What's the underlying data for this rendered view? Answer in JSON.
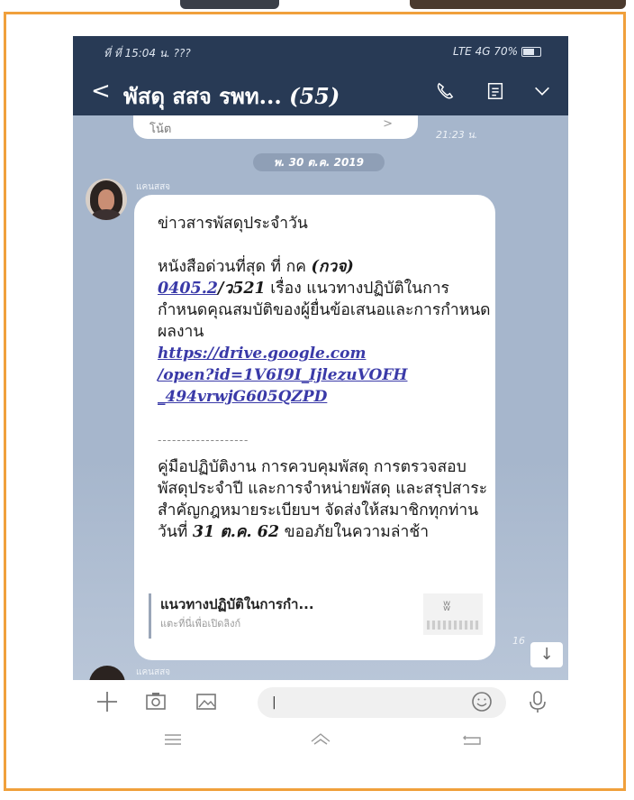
{
  "status_bar": {
    "left": "ที่ ที่ 15:04 น. ???",
    "right": "LTE 4G 70%"
  },
  "header": {
    "back_icon": "chevron-left-icon",
    "title": "พัสดุ สสจ รพท...",
    "member_count": "(55)",
    "icons": [
      "phone-icon",
      "notes-icon",
      "chevron-down-icon"
    ]
  },
  "chat": {
    "previous_bubble_text": "โน้ต",
    "previous_bubble_arrow": ">",
    "previous_time": "21:23 น.",
    "date_divider": "พ. 30 ต.ค. 2019",
    "sender_name": "แคนสสจ",
    "message": {
      "heading": "ข่าวสารพัสดุประจำวัน",
      "para1_a": "หนังสือด่วนที่สุด ที่ กค ",
      "para1_code": "(กวจ)",
      "para1_link": "0405.2",
      "para1_b": "/ว521",
      "para1_c": "  เรื่อง แนวทางปฏิบัติในการกำหนดคุณสมบัติของผู้ยื่นข้อเสนอและการกำหนดผลงาน",
      "url_line1": "https://drive.google.com",
      "url_line2": "/open?id=1V6I9I_IjlezuVOFH",
      "url_line3": "_494vrwjG605QZPD",
      "separator": "-------------------",
      "para2_a": "คู่มือปฏิบัติงาน การควบคุมพัสดุ การตรวจสอบพัสดุประจำปี และการจำหน่ายพัสดุ และสรุปสาระสำคัญกฎหมายระเบียบฯ จัดส่งให้สมาชิกทุกท่าน วันที่ ",
      "para2_date": "31 ต.ค. 62",
      "para2_b": " ขออภัยในความล่าช้า"
    },
    "link_preview": {
      "title": "แนวทางปฏิบัติในการกำ...",
      "subtitle": "แตะที่นี่เพื่อเปิดลิงก์"
    },
    "time_partial": "16",
    "scroll_down_icon": "arrow-down-icon",
    "next_sender": "แคนสสจ"
  },
  "input_bar": {
    "icons": [
      "plus-icon",
      "camera-icon",
      "image-icon",
      "emoji-icon",
      "microphone-icon"
    ],
    "text_value": "|"
  },
  "nav_bar": {
    "icons": [
      "menu-icon",
      "home-icon",
      "back-icon"
    ]
  },
  "colors": {
    "header_bg": "#283a55",
    "chat_bg": "#a6b6cc",
    "frame_border": "#f0a03c",
    "link": "#3a3aa8"
  }
}
